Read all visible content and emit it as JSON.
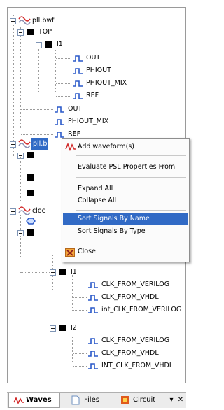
{
  "tree": {
    "top_group": {
      "file": "pll.bwf",
      "top": "TOP",
      "instance": "I1",
      "instance_signals": [
        "OUT",
        "PHIOUT",
        "PHIOUT_MIX",
        "REF"
      ],
      "top_signals": [
        "OUT",
        "PHIOUT_MIX",
        "REF"
      ]
    },
    "second_file": "pll.b",
    "third_file": "cloc",
    "bottom_group": {
      "i1": "I1",
      "i1_signals": [
        "CLK_FROM_VERILOG",
        "CLK_FROM_VHDL",
        "int_CLK_FROM_VERILOG"
      ],
      "i2": "I2",
      "i2_signals": [
        "CLK_FROM_VERILOG",
        "CLK_FROM_VHDL",
        "INT_CLK_FROM_VHDL"
      ]
    }
  },
  "context_menu": {
    "add_waveform": "Add waveform(s)",
    "evaluate_psl": "Evaluate PSL Properties From",
    "expand_all": "Expand All",
    "collapse_all": "Collapse All",
    "sort_by_name": "Sort Signals By Name",
    "sort_by_type": "Sort Signals By Type",
    "close": "Close",
    "highlighted_item": "Sort Signals By Name"
  },
  "tabs": {
    "waves": "Waves",
    "files": "Files",
    "circuit": "Circuit",
    "dropdown_glyph": "▾",
    "close_glyph": "✕"
  },
  "colors": {
    "selection": "#316ac5",
    "signal_icon": "#2a59c9",
    "wave_icon": "#d22b2b",
    "circuit_icon": "#e05a1c",
    "close_icon": "#d9722a"
  }
}
